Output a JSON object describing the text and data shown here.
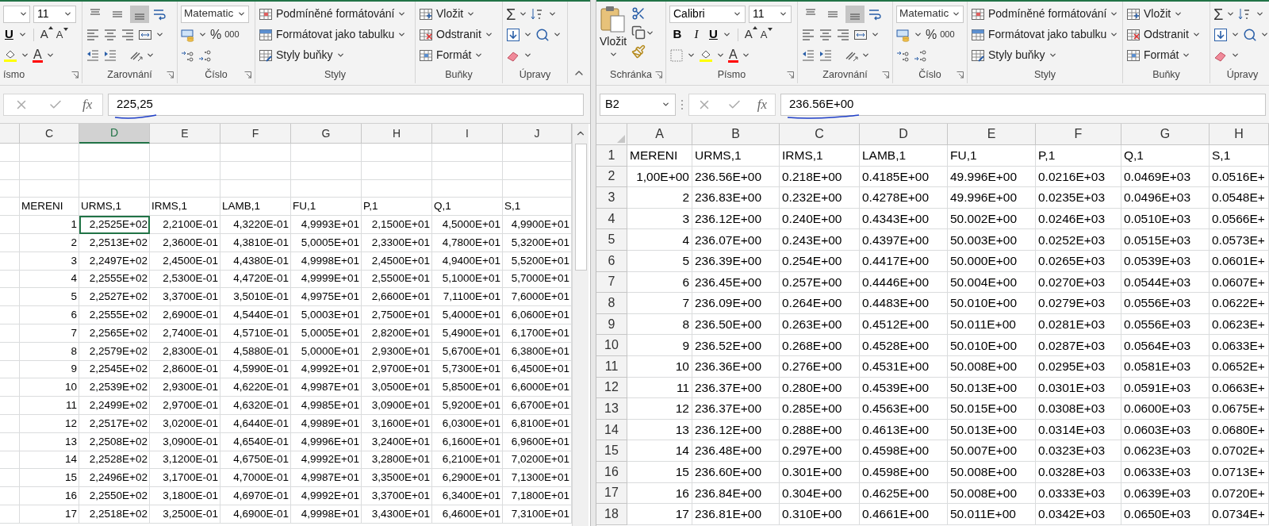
{
  "left_window": {
    "ribbon": {
      "font": {
        "size": "11",
        "underline": "U",
        "grow": "A",
        "shrink": "A",
        "font_color": "A",
        "label": "ísmo"
      },
      "alignment": {
        "vertical_buttons": [
          {
            "selected": false
          },
          {
            "selected": false
          },
          {
            "selected": true
          }
        ],
        "label": "Zarovnání"
      },
      "number": {
        "format": "Matematic",
        "percent": "%",
        "thousands": "000",
        "label": "Číslo"
      },
      "styles": {
        "items": [
          "Podmíněné formátování",
          "Formátovat jako tabulku",
          "Styly buňky"
        ],
        "label": "Styly"
      },
      "cells": {
        "items": [
          "Vložit",
          "Odstranit",
          "Formát"
        ],
        "label": "Buňky"
      },
      "editing": {
        "sum": "Σ",
        "label": "Úpravy"
      }
    },
    "formula_bar": {
      "fx": "fx",
      "value": "225,25"
    },
    "columns": [
      {
        "label": "C",
        "selected": false
      },
      {
        "label": "D",
        "selected": true
      },
      {
        "label": "E",
        "selected": false
      },
      {
        "label": "F",
        "selected": false
      },
      {
        "label": "G",
        "selected": false
      },
      {
        "label": "H",
        "selected": false
      },
      {
        "label": "I",
        "selected": false
      },
      {
        "label": "J",
        "selected": false
      }
    ],
    "rows": [
      {
        "kind": "header",
        "selected": false,
        "cells": [
          "MERENI",
          "URMS,1",
          "IRMS,1",
          "LAMB,1",
          "FU,1",
          "P,1",
          "Q,1",
          "S,1"
        ]
      },
      {
        "kind": "data",
        "selected": true,
        "cells": [
          "1",
          "2,2525E+02",
          "2,2100E-01",
          "4,3220E-01",
          "4,9993E+01",
          "2,1500E+01",
          "4,5000E+01",
          "4,9900E+01"
        ]
      },
      {
        "kind": "data",
        "selected": false,
        "cells": [
          "2",
          "2,2513E+02",
          "2,3600E-01",
          "4,3810E-01",
          "5,0005E+01",
          "2,3300E+01",
          "4,7800E+01",
          "5,3200E+01"
        ]
      },
      {
        "kind": "data",
        "selected": false,
        "cells": [
          "3",
          "2,2497E+02",
          "2,4500E-01",
          "4,4380E-01",
          "4,9998E+01",
          "2,4500E+01",
          "4,9400E+01",
          "5,5200E+01"
        ]
      },
      {
        "kind": "data",
        "selected": false,
        "cells": [
          "4",
          "2,2555E+02",
          "2,5300E-01",
          "4,4720E-01",
          "4,9999E+01",
          "2,5500E+01",
          "5,1000E+01",
          "5,7000E+01"
        ]
      },
      {
        "kind": "data",
        "selected": false,
        "cells": [
          "5",
          "2,2527E+02",
          "3,3700E-01",
          "3,5010E-01",
          "4,9975E+01",
          "2,6600E+01",
          "7,1100E+01",
          "7,6000E+01"
        ]
      },
      {
        "kind": "data",
        "selected": false,
        "cells": [
          "6",
          "2,2555E+02",
          "2,6900E-01",
          "4,5440E-01",
          "5,0003E+01",
          "2,7500E+01",
          "5,4000E+01",
          "6,0600E+01"
        ]
      },
      {
        "kind": "data",
        "selected": false,
        "cells": [
          "7",
          "2,2565E+02",
          "2,7400E-01",
          "4,5710E-01",
          "5,0005E+01",
          "2,8200E+01",
          "5,4900E+01",
          "6,1700E+01"
        ]
      },
      {
        "kind": "data",
        "selected": false,
        "cells": [
          "8",
          "2,2579E+02",
          "2,8300E-01",
          "4,5880E-01",
          "5,0000E+01",
          "2,9300E+01",
          "5,6700E+01",
          "6,3800E+01"
        ]
      },
      {
        "kind": "data",
        "selected": false,
        "cells": [
          "9",
          "2,2545E+02",
          "2,8600E-01",
          "4,5990E-01",
          "4,9992E+01",
          "2,9700E+01",
          "5,7300E+01",
          "6,4500E+01"
        ]
      },
      {
        "kind": "data",
        "selected": false,
        "cells": [
          "10",
          "2,2539E+02",
          "2,9300E-01",
          "4,6220E-01",
          "4,9987E+01",
          "3,0500E+01",
          "5,8500E+01",
          "6,6000E+01"
        ]
      },
      {
        "kind": "data",
        "selected": false,
        "cells": [
          "11",
          "2,2499E+02",
          "2,9700E-01",
          "4,6320E-01",
          "4,9985E+01",
          "3,0900E+01",
          "5,9200E+01",
          "6,6700E+01"
        ]
      },
      {
        "kind": "data",
        "selected": false,
        "cells": [
          "12",
          "2,2517E+02",
          "3,0200E-01",
          "4,6440E-01",
          "4,9989E+01",
          "3,1600E+01",
          "6,0300E+01",
          "6,8100E+01"
        ]
      },
      {
        "kind": "data",
        "selected": false,
        "cells": [
          "13",
          "2,2508E+02",
          "3,0900E-01",
          "4,6540E-01",
          "4,9996E+01",
          "3,2400E+01",
          "6,1600E+01",
          "6,9600E+01"
        ]
      },
      {
        "kind": "data",
        "selected": false,
        "cells": [
          "14",
          "2,2528E+02",
          "3,1200E-01",
          "4,6750E-01",
          "4,9992E+01",
          "3,2800E+01",
          "6,2100E+01",
          "7,0200E+01"
        ]
      },
      {
        "kind": "data",
        "selected": false,
        "cells": [
          "15",
          "2,2496E+02",
          "3,1700E-01",
          "4,7000E-01",
          "4,9987E+01",
          "3,3500E+01",
          "6,2900E+01",
          "7,1300E+01"
        ]
      },
      {
        "kind": "data",
        "selected": false,
        "cells": [
          "16",
          "2,2550E+02",
          "3,1800E-01",
          "4,6970E-01",
          "4,9992E+01",
          "3,3700E+01",
          "6,3400E+01",
          "7,1800E+01"
        ]
      },
      {
        "kind": "data",
        "selected": false,
        "cells": [
          "17",
          "2,2518E+02",
          "3,2500E-01",
          "4,6900E-01",
          "4,9998E+01",
          "3,4300E+01",
          "6,4600E+01",
          "7,3100E+01"
        ]
      }
    ]
  },
  "right_window": {
    "ribbon": {
      "clipboard": {
        "paste": "Vložit",
        "label": "Schránka"
      },
      "font": {
        "name": "Calibri",
        "size": "11",
        "bold": "B",
        "italic": "I",
        "underline": "U",
        "grow": "A",
        "shrink": "A",
        "font_color": "A",
        "label": "Písmo"
      },
      "alignment": {
        "vertical_buttons": [
          {
            "selected": false
          },
          {
            "selected": false
          },
          {
            "selected": true
          }
        ],
        "label": "Zarovnání"
      },
      "number": {
        "format": "Matematic",
        "percent": "%",
        "thousands": "000",
        "label": "Číslo"
      },
      "styles": {
        "items": [
          "Podmíněné formátování",
          "Formátovat jako tabulku",
          "Styly buňky"
        ],
        "label": "Styly"
      },
      "cells": {
        "items": [
          "Vložit",
          "Odstranit",
          "Formát"
        ],
        "label": "Buňky"
      },
      "editing": {
        "sum": "Σ",
        "label": "Úpravy"
      }
    },
    "formula_bar": {
      "name_box": "B2",
      "fx": "fx",
      "value": "236.56E+00"
    },
    "values_as_text": true,
    "columns": [
      {
        "label": "A"
      },
      {
        "label": "B"
      },
      {
        "label": "C"
      },
      {
        "label": "D"
      },
      {
        "label": "E"
      },
      {
        "label": "F"
      },
      {
        "label": "G"
      },
      {
        "label": "H"
      }
    ],
    "rows": [
      {
        "number": "1",
        "kind": "header",
        "cells": [
          "MERENI",
          "URMS,1",
          "IRMS,1",
          "LAMB,1",
          "FU,1",
          "P,1",
          "Q,1",
          "S,1"
        ]
      },
      {
        "number": "2",
        "kind": "data",
        "cells": [
          "1,00E+00",
          "236.56E+00",
          "0.218E+00",
          "0.4185E+00",
          "49.996E+00",
          "0.0216E+03",
          "0.0469E+03",
          "0.0516E+"
        ]
      },
      {
        "number": "3",
        "kind": "data",
        "cells": [
          "2",
          "236.83E+00",
          "0.232E+00",
          "0.4278E+00",
          "49.996E+00",
          "0.0235E+03",
          "0.0496E+03",
          "0.0548E+"
        ]
      },
      {
        "number": "4",
        "kind": "data",
        "cells": [
          "3",
          "236.12E+00",
          "0.240E+00",
          "0.4343E+00",
          "50.002E+00",
          "0.0246E+03",
          "0.0510E+03",
          "0.0566E+"
        ]
      },
      {
        "number": "5",
        "kind": "data",
        "cells": [
          "4",
          "236.07E+00",
          "0.243E+00",
          "0.4397E+00",
          "50.003E+00",
          "0.0252E+03",
          "0.0515E+03",
          "0.0573E+"
        ]
      },
      {
        "number": "6",
        "kind": "data",
        "cells": [
          "5",
          "236.39E+00",
          "0.254E+00",
          "0.4417E+00",
          "50.000E+00",
          "0.0265E+03",
          "0.0539E+03",
          "0.0601E+"
        ]
      },
      {
        "number": "7",
        "kind": "data",
        "cells": [
          "6",
          "236.45E+00",
          "0.257E+00",
          "0.4446E+00",
          "50.004E+00",
          "0.0270E+03",
          "0.0544E+03",
          "0.0607E+"
        ]
      },
      {
        "number": "8",
        "kind": "data",
        "cells": [
          "7",
          "236.09E+00",
          "0.264E+00",
          "0.4483E+00",
          "50.010E+00",
          "0.0279E+03",
          "0.0556E+03",
          "0.0622E+"
        ]
      },
      {
        "number": "9",
        "kind": "data",
        "cells": [
          "8",
          "236.50E+00",
          "0.263E+00",
          "0.4512E+00",
          "50.011E+00",
          "0.0281E+03",
          "0.0556E+03",
          "0.0623E+"
        ]
      },
      {
        "number": "10",
        "kind": "data",
        "cells": [
          "9",
          "236.52E+00",
          "0.268E+00",
          "0.4528E+00",
          "50.010E+00",
          "0.0287E+03",
          "0.0564E+03",
          "0.0633E+"
        ]
      },
      {
        "number": "11",
        "kind": "data",
        "cells": [
          "10",
          "236.36E+00",
          "0.276E+00",
          "0.4531E+00",
          "50.008E+00",
          "0.0295E+03",
          "0.0581E+03",
          "0.0652E+"
        ]
      },
      {
        "number": "12",
        "kind": "data",
        "cells": [
          "11",
          "236.37E+00",
          "0.280E+00",
          "0.4539E+00",
          "50.013E+00",
          "0.0301E+03",
          "0.0591E+03",
          "0.0663E+"
        ]
      },
      {
        "number": "13",
        "kind": "data",
        "cells": [
          "12",
          "236.37E+00",
          "0.285E+00",
          "0.4563E+00",
          "50.015E+00",
          "0.0308E+03",
          "0.0600E+03",
          "0.0675E+"
        ]
      },
      {
        "number": "14",
        "kind": "data",
        "cells": [
          "13",
          "236.12E+00",
          "0.288E+00",
          "0.4613E+00",
          "50.013E+00",
          "0.0314E+03",
          "0.0603E+03",
          "0.0680E+"
        ]
      },
      {
        "number": "15",
        "kind": "data",
        "cells": [
          "14",
          "236.48E+00",
          "0.297E+00",
          "0.4598E+00",
          "50.007E+00",
          "0.0323E+03",
          "0.0623E+03",
          "0.0702E+"
        ]
      },
      {
        "number": "16",
        "kind": "data",
        "cells": [
          "15",
          "236.60E+00",
          "0.301E+00",
          "0.4598E+00",
          "50.008E+00",
          "0.0328E+03",
          "0.0633E+03",
          "0.0713E+"
        ]
      },
      {
        "number": "17",
        "kind": "data",
        "cells": [
          "16",
          "236.84E+00",
          "0.304E+00",
          "0.4625E+00",
          "50.008E+00",
          "0.0333E+03",
          "0.0639E+03",
          "0.0720E+"
        ]
      },
      {
        "number": "18",
        "kind": "data",
        "cells": [
          "17",
          "236.81E+00",
          "0.310E+00",
          "0.4661E+00",
          "50.011E+00",
          "0.0342E+03",
          "0.0650E+03",
          "0.0734E+"
        ]
      }
    ]
  }
}
